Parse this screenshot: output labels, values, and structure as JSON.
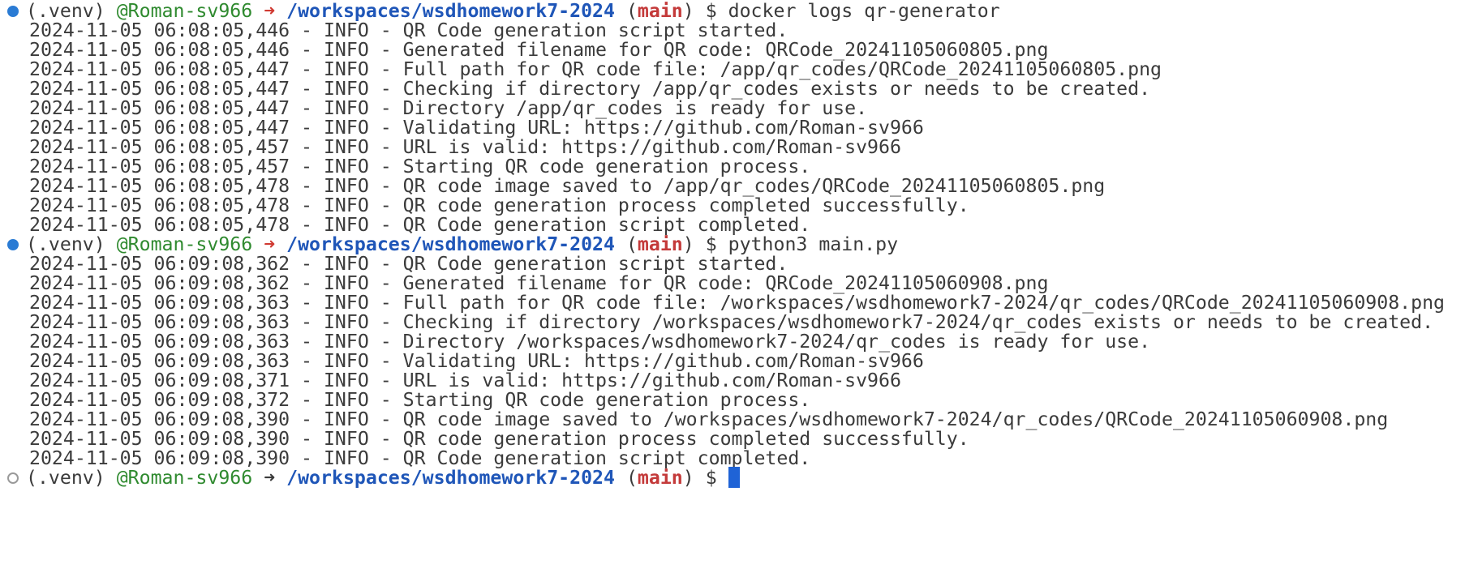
{
  "terminal": {
    "prompt": {
      "venv": "(.venv)",
      "user": "@Roman-sv966",
      "arrow": "➜",
      "path": "/workspaces/wsdhomework7-2024",
      "paren_open": "(",
      "branch": "main",
      "paren_close": ")",
      "dollar": "$"
    },
    "blocks": [
      {
        "command": "docker logs qr-generator",
        "output": [
          "2024-11-05 06:08:05,446 - INFO - QR Code generation script started.",
          "2024-11-05 06:08:05,446 - INFO - Generated filename for QR code: QRCode_20241105060805.png",
          "2024-11-05 06:08:05,447 - INFO - Full path for QR code file: /app/qr_codes/QRCode_20241105060805.png",
          "2024-11-05 06:08:05,447 - INFO - Checking if directory /app/qr_codes exists or needs to be created.",
          "2024-11-05 06:08:05,447 - INFO - Directory /app/qr_codes is ready for use.",
          "2024-11-05 06:08:05,447 - INFO - Validating URL: https://github.com/Roman-sv966",
          "2024-11-05 06:08:05,457 - INFO - URL is valid: https://github.com/Roman-sv966",
          "2024-11-05 06:08:05,457 - INFO - Starting QR code generation process.",
          "2024-11-05 06:08:05,478 - INFO - QR code image saved to /app/qr_codes/QRCode_20241105060805.png",
          "2024-11-05 06:08:05,478 - INFO - QR code generation process completed successfully.",
          "2024-11-05 06:08:05,478 - INFO - QR Code generation script completed."
        ]
      },
      {
        "command": "python3 main.py",
        "output": [
          "2024-11-05 06:09:08,362 - INFO - QR Code generation script started.",
          "2024-11-05 06:09:08,362 - INFO - Generated filename for QR code: QRCode_20241105060908.png",
          "2024-11-05 06:09:08,363 - INFO - Full path for QR code file: /workspaces/wsdhomework7-2024/qr_codes/QRCode_20241105060908.png",
          "2024-11-05 06:09:08,363 - INFO - Checking if directory /workspaces/wsdhomework7-2024/qr_codes exists or needs to be created.",
          "2024-11-05 06:09:08,363 - INFO - Directory /workspaces/wsdhomework7-2024/qr_codes is ready for use.",
          "2024-11-05 06:09:08,363 - INFO - Validating URL: https://github.com/Roman-sv966",
          "2024-11-05 06:09:08,371 - INFO - URL is valid: https://github.com/Roman-sv966",
          "2024-11-05 06:09:08,372 - INFO - Starting QR code generation process.",
          "2024-11-05 06:09:08,390 - INFO - QR code image saved to /workspaces/wsdhomework7-2024/qr_codes/QRCode_20241105060908.png",
          "2024-11-05 06:09:08,390 - INFO - QR code generation process completed successfully.",
          "2024-11-05 06:09:08,390 - INFO - QR Code generation script completed."
        ]
      }
    ],
    "colors": {
      "dot_success": "#2a7bd4",
      "dot_idle": "#9a9a9a",
      "user": "#2f8a2f",
      "arrow": "#d03a32",
      "path": "#1f56b8",
      "branch": "#c43a3a",
      "text": "#3b3b3b",
      "cursor": "#1f63d6"
    }
  }
}
